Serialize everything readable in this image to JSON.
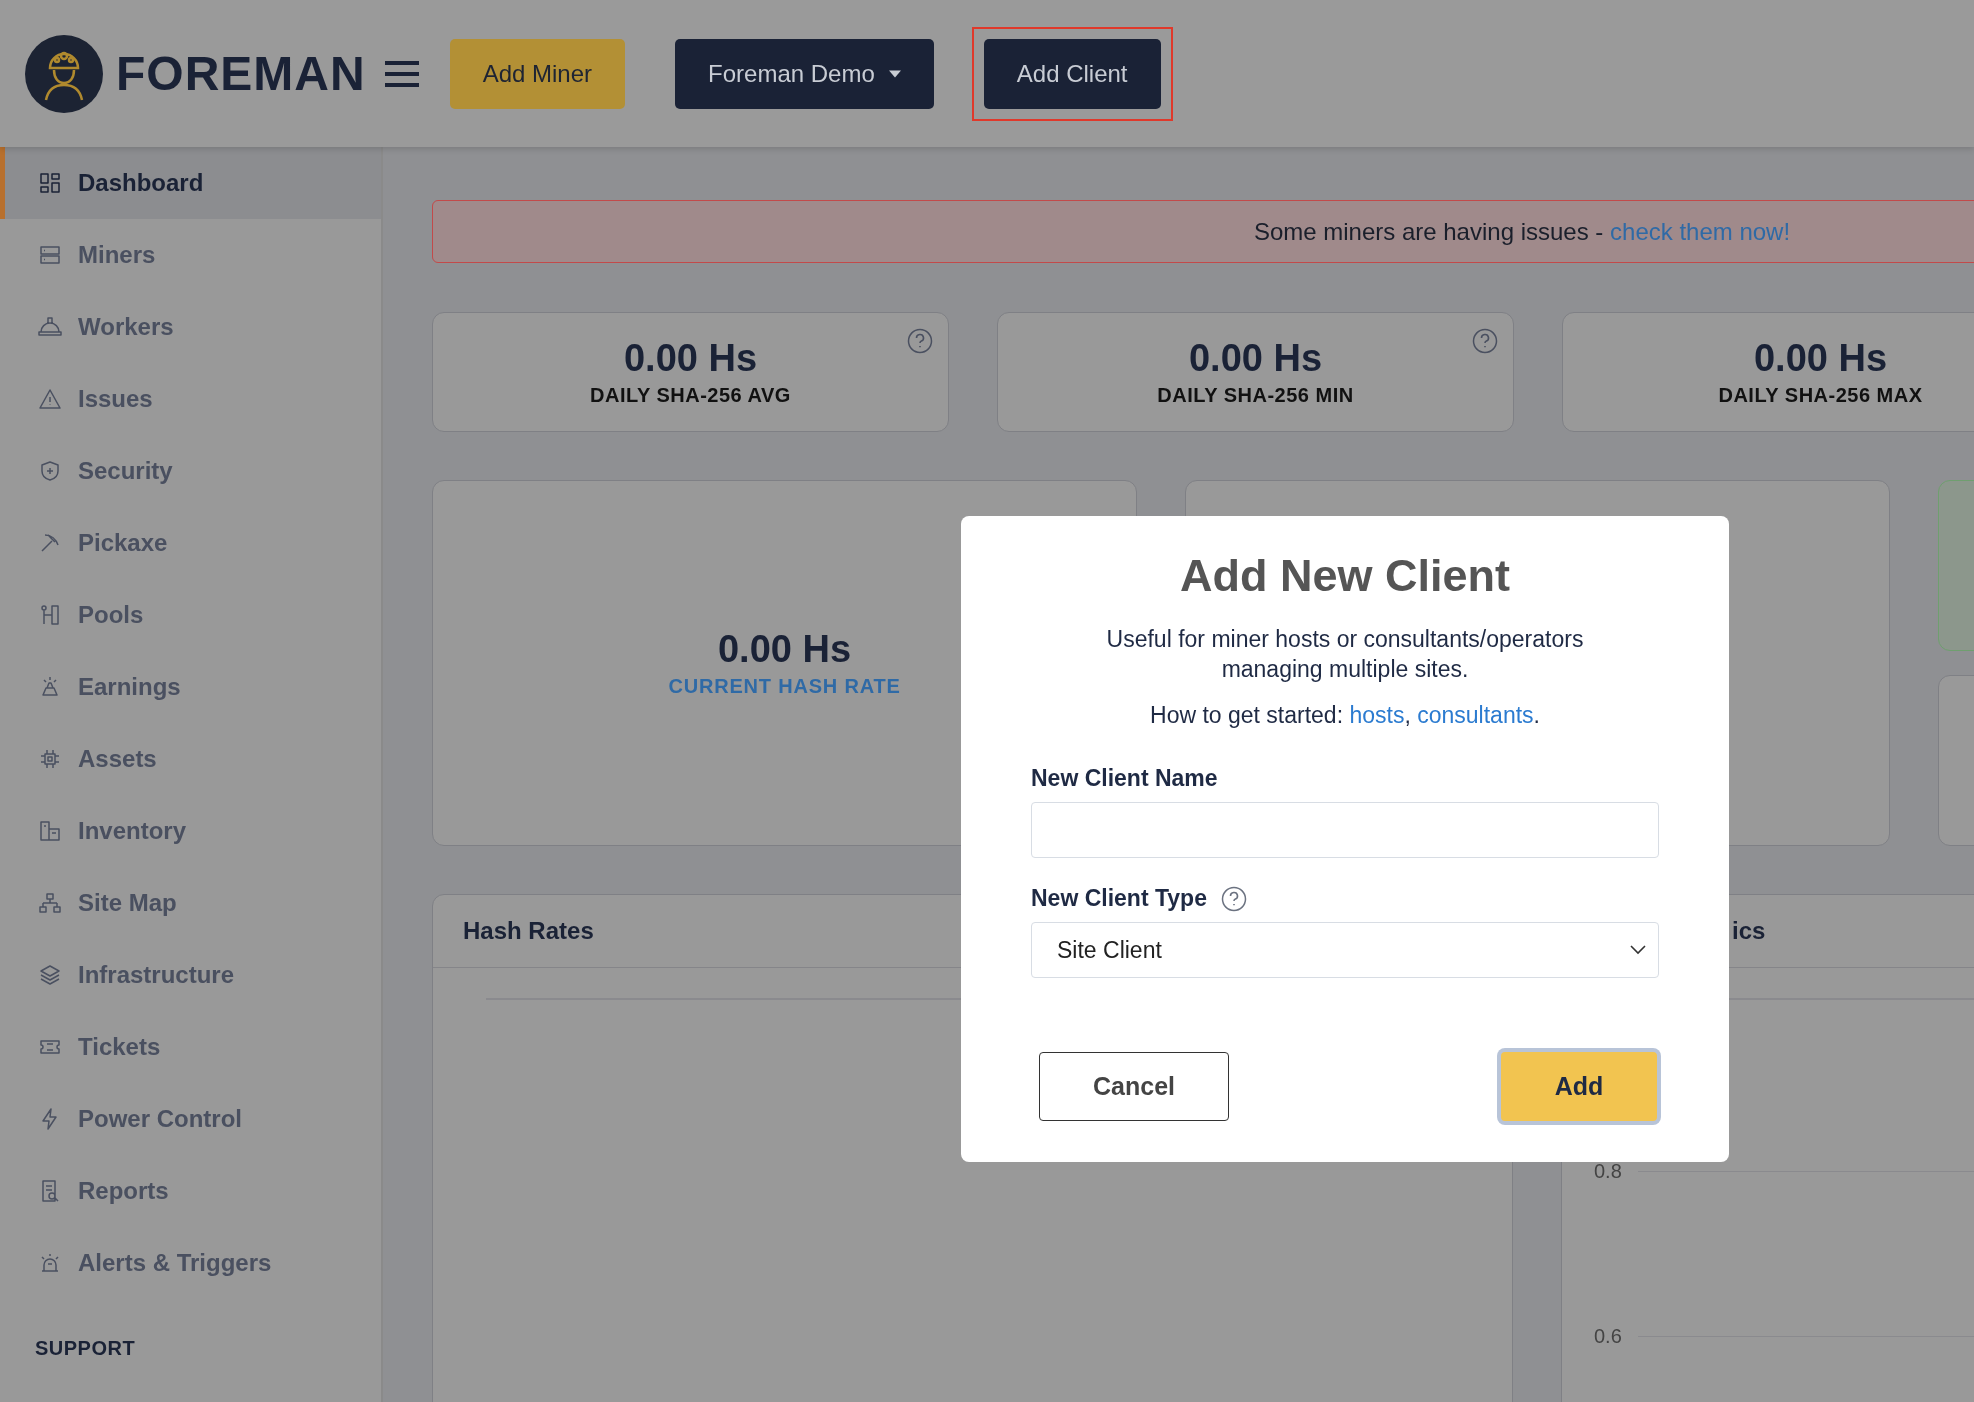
{
  "header": {
    "brand": "FOREMAN",
    "buttons": [
      {
        "label": "Add Miner",
        "kind": "accent",
        "highlighted": false
      },
      {
        "label": "Foreman Demo",
        "kind": "dropdown",
        "highlighted": false
      },
      {
        "label": "Add Client",
        "kind": "dark",
        "highlighted": true
      }
    ]
  },
  "sidebar": {
    "items": [
      {
        "label": "Dashboard",
        "selected": true
      },
      {
        "label": "Miners",
        "selected": false
      },
      {
        "label": "Workers",
        "selected": false
      },
      {
        "label": "Issues",
        "selected": false
      },
      {
        "label": "Security",
        "selected": false
      },
      {
        "label": "Pickaxe",
        "selected": false
      },
      {
        "label": "Pools",
        "selected": false
      },
      {
        "label": "Earnings",
        "selected": false
      },
      {
        "label": "Assets",
        "selected": false
      },
      {
        "label": "Inventory",
        "selected": false
      },
      {
        "label": "Site Map",
        "selected": false
      },
      {
        "label": "Infrastructure",
        "selected": false
      },
      {
        "label": "Tickets",
        "selected": false
      },
      {
        "label": "Power Control",
        "selected": false
      },
      {
        "label": "Reports",
        "selected": false
      },
      {
        "label": "Alerts & Triggers",
        "selected": false
      }
    ],
    "section": "SUPPORT"
  },
  "alert": {
    "text": "Some miners are having issues - ",
    "link": "check them now!"
  },
  "stats": [
    {
      "value": "0.00 Hs",
      "label": "DAILY SHA-256 AVG",
      "help": true
    },
    {
      "value": "0.00 Hs",
      "label": "DAILY SHA-256 MIN",
      "help": true
    },
    {
      "value": "0.00 Hs",
      "label": "DAILY SHA-256 MAX"
    }
  ],
  "current": {
    "value": "0.00 Hs",
    "label": "CURRENT HASH RATE"
  },
  "panels": [
    {
      "title": "Hash Rates"
    },
    {
      "title": "ics",
      "axis_labels": [
        "0.8",
        "0.6"
      ]
    }
  ],
  "modal": {
    "title": "Add New Client",
    "description": "Useful for miner hosts or consultants/operators managing multiple sites.",
    "started": [
      {
        "kind": "text",
        "text": "How to get started: "
      },
      {
        "kind": "link",
        "text": "hosts"
      },
      {
        "kind": "text",
        "text": ", "
      },
      {
        "kind": "link",
        "text": "consultants"
      },
      {
        "kind": "text",
        "text": "."
      }
    ],
    "fields": [
      {
        "label": "New Client Name",
        "kind": "text"
      },
      {
        "label": "New Client Type",
        "kind": "select",
        "value": "Site Client",
        "help": true
      }
    ],
    "buttons": [
      {
        "label": "Cancel",
        "kind": "secondary",
        "focused": false
      },
      {
        "label": "Add",
        "kind": "primary",
        "focused": true
      }
    ]
  }
}
